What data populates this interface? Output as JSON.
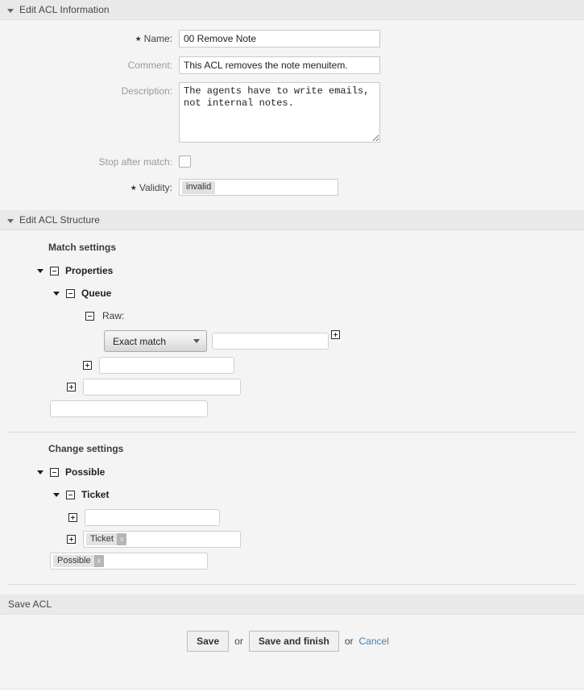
{
  "sections": {
    "info": {
      "title": "Edit ACL Information"
    },
    "structure": {
      "title": "Edit ACL Structure"
    },
    "save": {
      "title": "Save ACL"
    }
  },
  "form": {
    "name": {
      "label": "Name:",
      "value": "00 Remove Note",
      "required": true
    },
    "comment": {
      "label": "Comment:",
      "value": "This ACL removes the note menuitem.",
      "required": false
    },
    "description": {
      "label": "Description:",
      "value": "The agents have to write emails,\nnot internal notes.",
      "required": false
    },
    "stop_after_match": {
      "label": "Stop after match:",
      "checked": false
    },
    "validity": {
      "label": "Validity:",
      "value": "invalid",
      "required": true
    }
  },
  "structure": {
    "match": {
      "title": "Match settings",
      "properties_label": "Properties",
      "queue_label": "Queue",
      "raw_label": "Raw:",
      "match_type": "Exact match",
      "match_value": "",
      "new_value": "",
      "new_attribute": "",
      "new_section": ""
    },
    "change": {
      "title": "Change settings",
      "possible_label": "Possible",
      "ticket_label": "Ticket",
      "new_value": "",
      "ticket_chip": "Ticket",
      "possible_chip": "Possible",
      "chip_remove": "x"
    }
  },
  "footer": {
    "save_label": "Save",
    "or_1": "or",
    "save_and_finish_label": "Save and finish",
    "or_2": "or",
    "cancel_label": "Cancel"
  }
}
